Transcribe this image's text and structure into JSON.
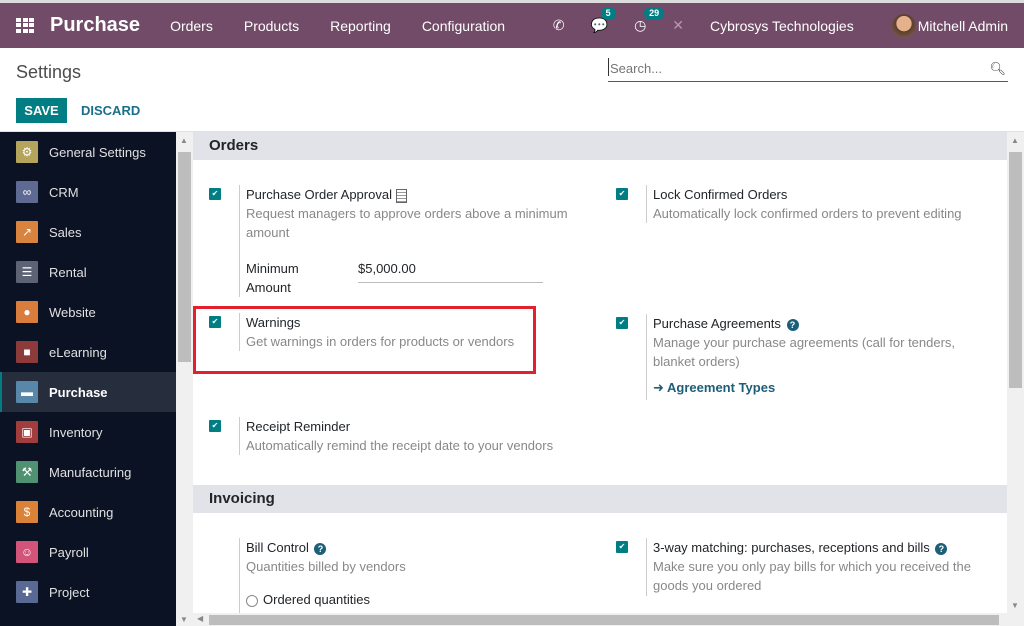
{
  "navbar": {
    "app_name": "Purchase",
    "menu": [
      "Orders",
      "Products",
      "Reporting",
      "Configuration"
    ],
    "messages_count": "5",
    "activities_count": "29",
    "company": "Cybrosys Technologies",
    "user": "Mitchell Admin"
  },
  "control_panel": {
    "title": "Settings",
    "search_placeholder": "Search...",
    "save_label": "SAVE",
    "discard_label": "DISCARD"
  },
  "sidebar": {
    "items": [
      {
        "label": "General Settings",
        "icon": "gear-icon",
        "color": "#b5a45c"
      },
      {
        "label": "CRM",
        "icon": "handshake-icon",
        "color": "#5f6a93"
      },
      {
        "label": "Sales",
        "icon": "chart-icon",
        "color": "#d8843f"
      },
      {
        "label": "Rental",
        "icon": "rental-icon",
        "color": "#5d6375"
      },
      {
        "label": "Website",
        "icon": "globe-icon",
        "color": "#da7d3c"
      },
      {
        "label": "eLearning",
        "icon": "elearning-icon",
        "color": "#8c3a3a"
      },
      {
        "label": "Purchase",
        "icon": "purchase-icon",
        "color": "#5987a9",
        "active": true
      },
      {
        "label": "Inventory",
        "icon": "box-icon",
        "color": "#a23d3d"
      },
      {
        "label": "Manufacturing",
        "icon": "wrench-icon",
        "color": "#4f9170"
      },
      {
        "label": "Accounting",
        "icon": "invoice-icon",
        "color": "#d98238"
      },
      {
        "label": "Payroll",
        "icon": "payroll-icon",
        "color": "#d3547a"
      },
      {
        "label": "Project",
        "icon": "puzzle-icon",
        "color": "#5a6894"
      }
    ]
  },
  "sections": {
    "orders": {
      "title": "Orders",
      "po_approval": {
        "title": "Purchase Order Approval",
        "desc": "Request managers to approve orders above a minimum amount",
        "checked": true,
        "min_label": "Minimum Amount",
        "min_value": "$5,000.00"
      },
      "lock_orders": {
        "title": "Lock Confirmed Orders",
        "desc": "Automatically lock confirmed orders to prevent editing",
        "checked": true
      },
      "warnings": {
        "title": "Warnings",
        "desc": "Get warnings in orders for products or vendors",
        "checked": true
      },
      "agreements": {
        "title": "Purchase Agreements",
        "desc": "Manage your purchase agreements (call for tenders, blanket orders)",
        "checked": true,
        "link": "Agreement Types"
      },
      "receipt_reminder": {
        "title": "Receipt Reminder",
        "desc": "Automatically remind the receipt date to your vendors",
        "checked": true
      }
    },
    "invoicing": {
      "title": "Invoicing",
      "bill_control": {
        "title": "Bill Control",
        "desc": "Quantities billed by vendors",
        "option": "Ordered quantities"
      },
      "three_way": {
        "title": "3-way matching: purchases, receptions and bills",
        "desc": "Make sure you only pay bills for which you received the goods you ordered",
        "checked": true
      }
    }
  }
}
